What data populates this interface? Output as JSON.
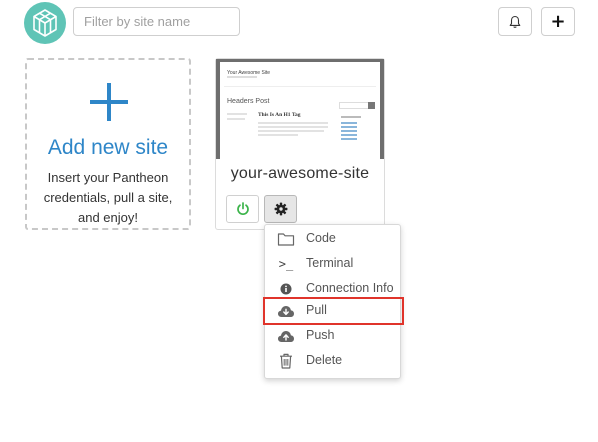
{
  "header": {
    "logo_icon": "pantheon-cube-logo-icon",
    "filter_placeholder": "Filter by site name",
    "notifications_icon": "bell-icon",
    "add_icon": "plus-icon",
    "add_glyph": "+"
  },
  "add_site_card": {
    "icon": "plus-icon",
    "title": "Add new site",
    "description": "Insert your Pantheon credentials, pull a site, and enjoy!"
  },
  "site_card": {
    "name": "your-awesome-site",
    "thumbnail": {
      "site_title": "Your Awesome Site",
      "heading": "Headers Post",
      "post_title": "This Is An H1 Tag"
    },
    "power_icon": "power-icon",
    "settings_icon": "gear-icon"
  },
  "menu": {
    "items": [
      {
        "label": "Code",
        "icon": "folder-icon"
      },
      {
        "label": "Terminal",
        "icon": "terminal-icon",
        "glyph": ">_"
      },
      {
        "label": "Connection Info",
        "icon": "info-icon"
      },
      {
        "label": "Pull",
        "icon": "cloud-download-icon",
        "highlighted": true
      },
      {
        "label": "Push",
        "icon": "cloud-upload-icon"
      },
      {
        "label": "Delete",
        "icon": "trash-icon"
      }
    ]
  },
  "colors": {
    "accent": "#2e86c8",
    "logo": "#5fc4b6",
    "power": "#3cb44b",
    "highlight": "#e0342b"
  }
}
